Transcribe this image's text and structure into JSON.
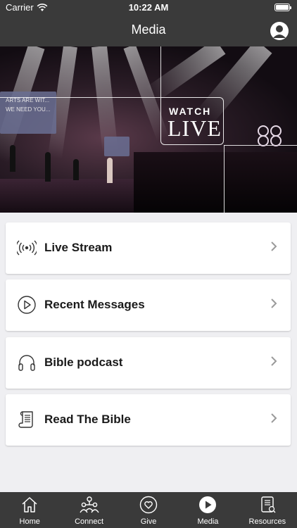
{
  "status_bar": {
    "carrier": "Carrier",
    "time": "10:22 AM"
  },
  "header": {
    "title": "Media"
  },
  "hero": {
    "watch_text": "WATCH",
    "live_text": "LIVE",
    "slide_line1": "ARTS ARE WIT...",
    "slide_line2": "WE NEED YOU..."
  },
  "menu": {
    "items": [
      {
        "label": "Live Stream",
        "icon": "broadcast-icon"
      },
      {
        "label": "Recent Messages",
        "icon": "play-circle-icon"
      },
      {
        "label": "Bible podcast",
        "icon": "headphones-icon"
      },
      {
        "label": "Read The Bible",
        "icon": "scroll-icon"
      }
    ]
  },
  "tabbar": {
    "tabs": [
      {
        "label": "Home",
        "icon": "home-icon"
      },
      {
        "label": "Connect",
        "icon": "people-icon"
      },
      {
        "label": "Give",
        "icon": "heart-icon"
      },
      {
        "label": "Media",
        "icon": "play-icon",
        "active": true
      },
      {
        "label": "Resources",
        "icon": "tablet-icon"
      }
    ]
  },
  "colors": {
    "bar": "#3a3a3a",
    "background": "#efeff2",
    "card": "#ffffff"
  }
}
